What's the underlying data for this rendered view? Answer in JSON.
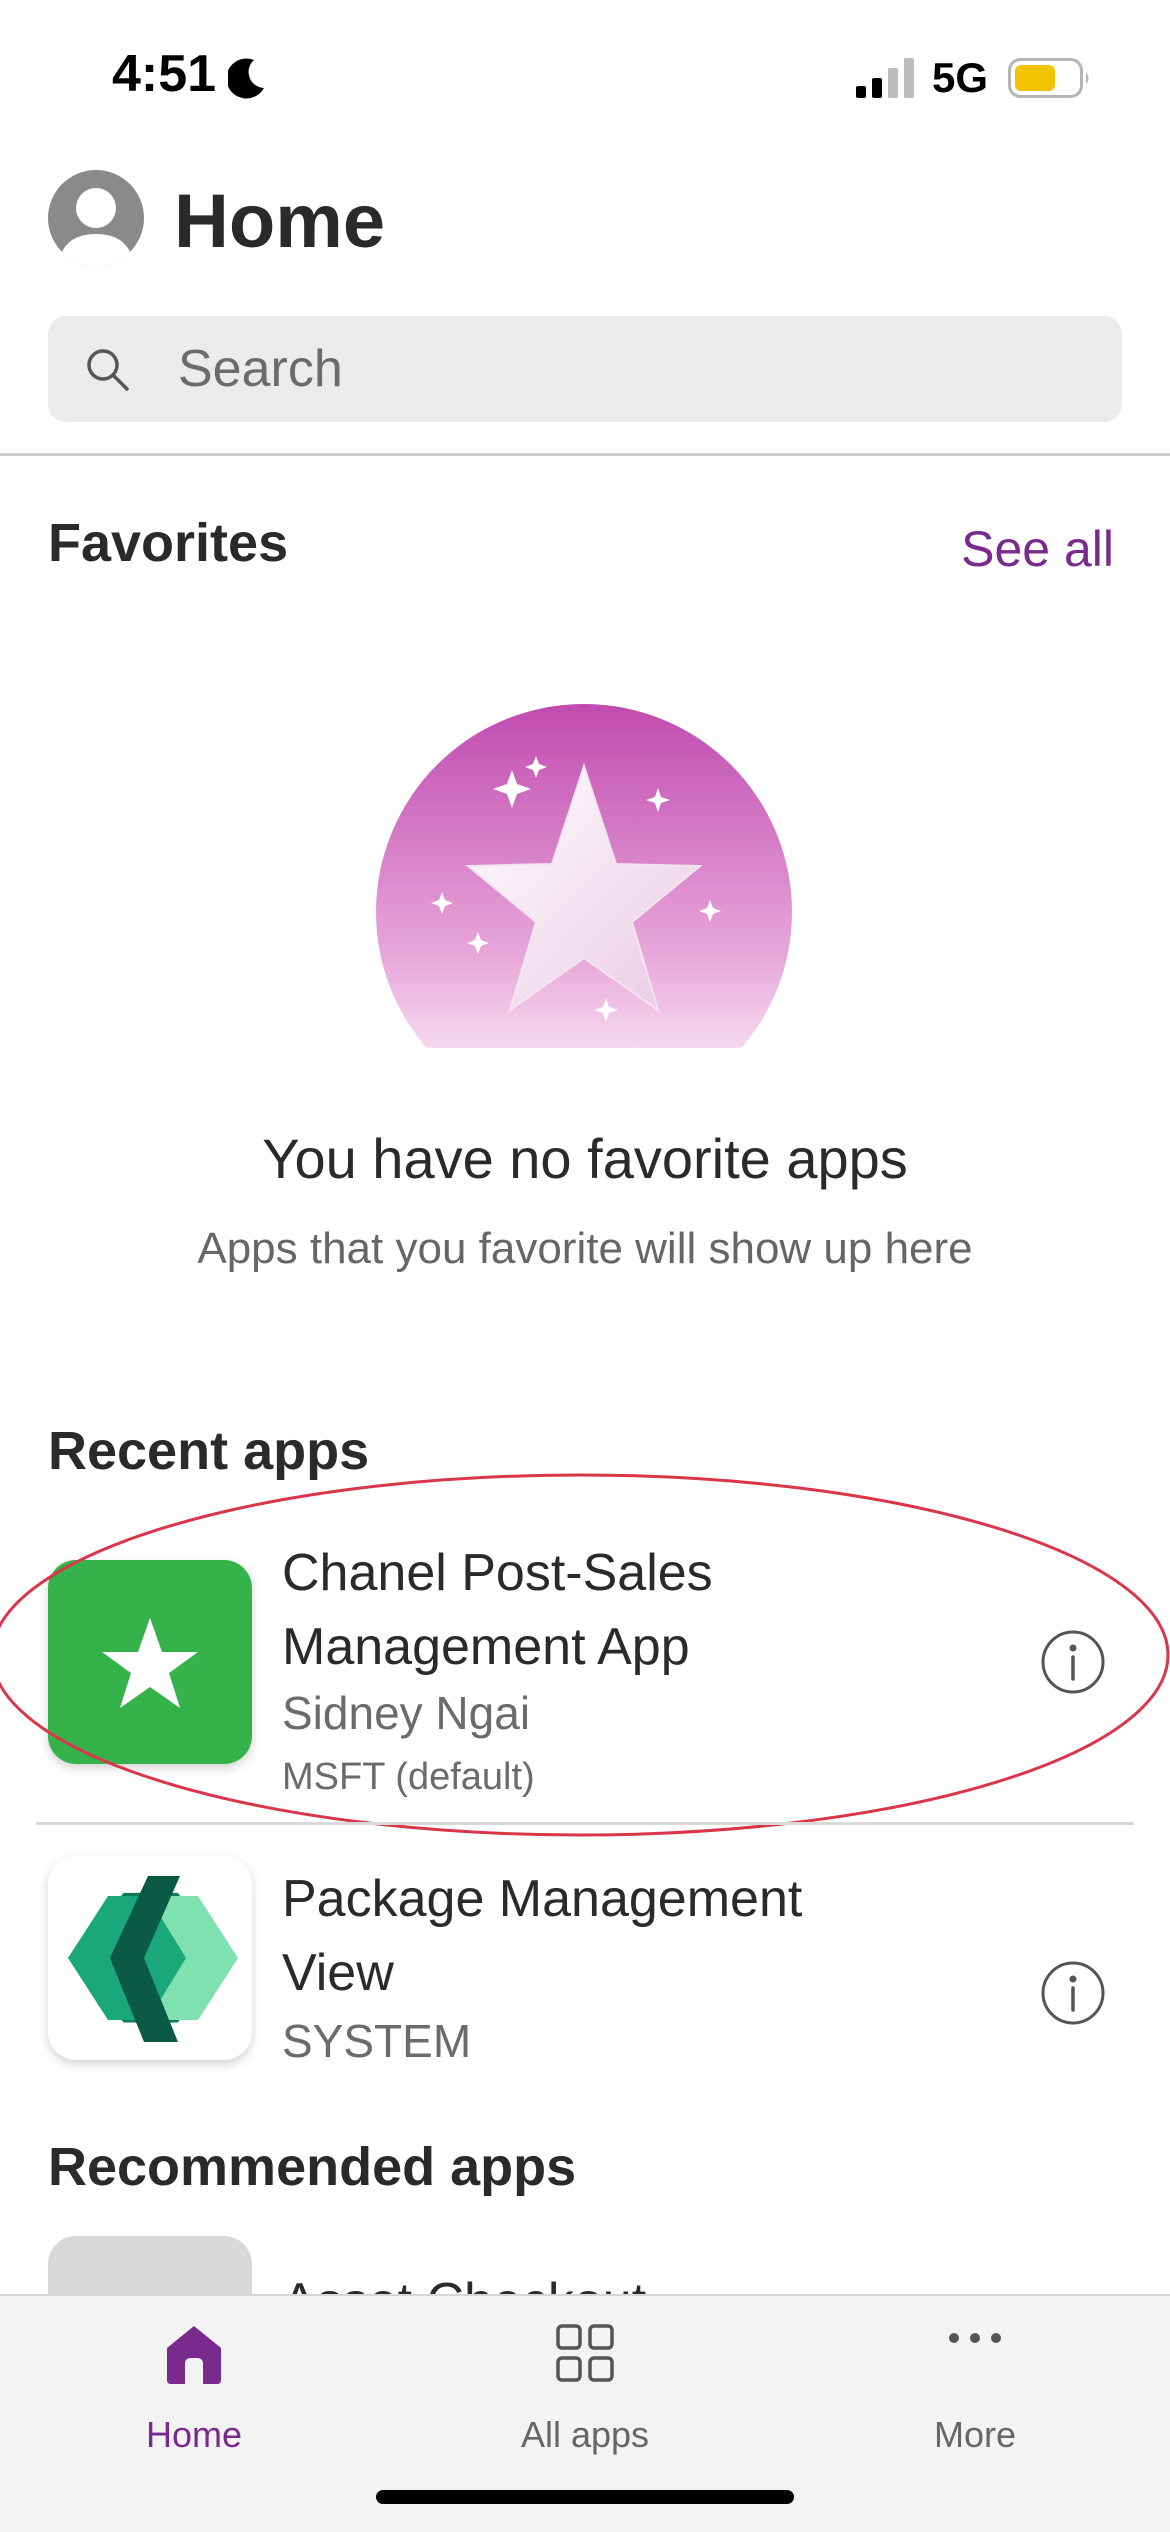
{
  "status_bar": {
    "time": "4:51",
    "network": "5G"
  },
  "header": {
    "title": "Home"
  },
  "search": {
    "placeholder": "Search"
  },
  "favorites": {
    "title": "Favorites",
    "see_all": "See all",
    "empty_title": "You have no favorite apps",
    "empty_subtitle": "Apps that you favorite will show up here"
  },
  "recent_apps": {
    "title": "Recent apps",
    "items": [
      {
        "name_line1": "Chanel Post-Sales",
        "name_line2": "Management App",
        "owner": "Sidney  Ngai",
        "environment": "MSFT (default)",
        "icon": "star-icon",
        "icon_color": "#36b24a"
      },
      {
        "name_line1": "Package Management",
        "name_line2": "View",
        "owner": "SYSTEM",
        "icon": "power-apps-logo"
      }
    ]
  },
  "recommended_apps": {
    "title": "Recommended apps",
    "partial_item": "Asset Checkout"
  },
  "bottom_nav": {
    "items": [
      {
        "label": "Home",
        "icon": "home-icon",
        "active": true
      },
      {
        "label": "All apps",
        "icon": "grid-icon",
        "active": false
      },
      {
        "label": "More",
        "icon": "more-icon",
        "active": false
      }
    ]
  },
  "colors": {
    "accent": "#7a2a8c",
    "favorite_gradient_top": "#c04bb0",
    "app_green": "#36b24a",
    "annotation_red": "#d9364a"
  }
}
